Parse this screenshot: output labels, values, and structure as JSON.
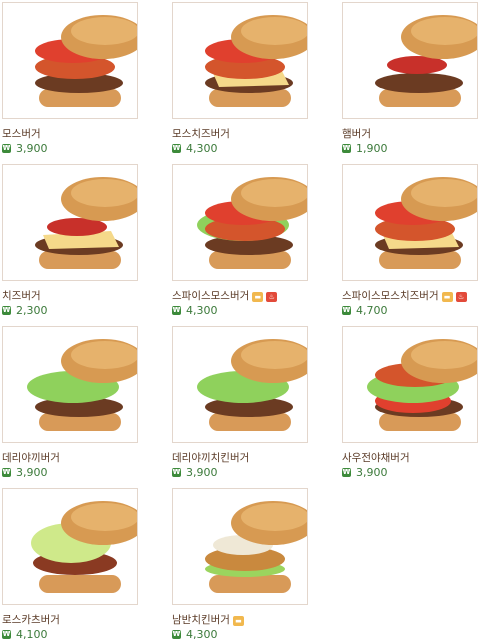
{
  "currency_icon": "won-icon",
  "badges": {
    "set": "set-badge-icon",
    "spicy": "spicy-chili-icon"
  },
  "items": [
    {
      "name": "모스버거",
      "price": "3,900",
      "variant": "mos",
      "badges": []
    },
    {
      "name": "모스치즈버거",
      "price": "4,300",
      "variant": "moscheese",
      "badges": []
    },
    {
      "name": "햄버거",
      "price": "1,900",
      "variant": "ham",
      "badges": []
    },
    {
      "name": "치즈버거",
      "price": "2,300",
      "variant": "cheese",
      "badges": []
    },
    {
      "name": "스파이스모스버거",
      "price": "4,300",
      "variant": "spicy",
      "badges": [
        "set",
        "spicy"
      ]
    },
    {
      "name": "스파이스모스치즈버거",
      "price": "4,700",
      "variant": "spicycheese",
      "badges": [
        "set",
        "spicy"
      ]
    },
    {
      "name": "데리야끼버거",
      "price": "3,900",
      "variant": "teri",
      "badges": []
    },
    {
      "name": "데리야끼치킨버거",
      "price": "3,900",
      "variant": "terichicken",
      "badges": []
    },
    {
      "name": "사우전야채버거",
      "price": "3,900",
      "variant": "veg",
      "badges": []
    },
    {
      "name": "로스카츠버거",
      "price": "4,100",
      "variant": "katsu",
      "badges": []
    },
    {
      "name": "남반치킨버거",
      "price": "4,300",
      "variant": "nanban",
      "badges": [
        "set"
      ]
    }
  ]
}
